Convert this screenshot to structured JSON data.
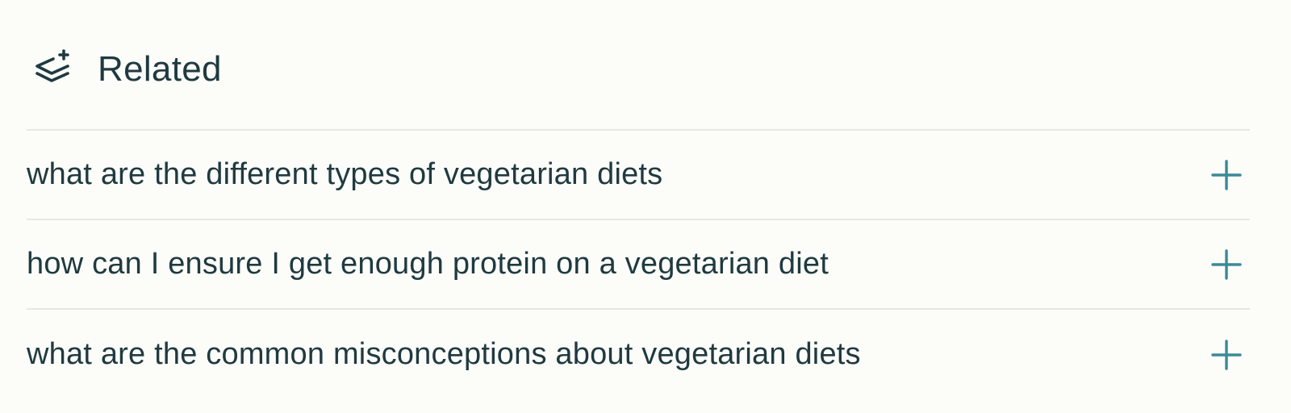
{
  "header": {
    "icon": "stack-plus-icon",
    "title": "Related"
  },
  "related": {
    "items": [
      {
        "label": "what are the different types of vegetarian diets",
        "icon": "plus-icon"
      },
      {
        "label": "how can I ensure I get enough protein on a vegetarian diet",
        "icon": "plus-icon"
      },
      {
        "label": "what are the common misconceptions about vegetarian diets",
        "icon": "plus-icon"
      }
    ]
  },
  "colors": {
    "background": "#fcfcf9",
    "text": "#1f3a40",
    "accent": "#3b8a96",
    "divider": "#e7e8e4"
  }
}
